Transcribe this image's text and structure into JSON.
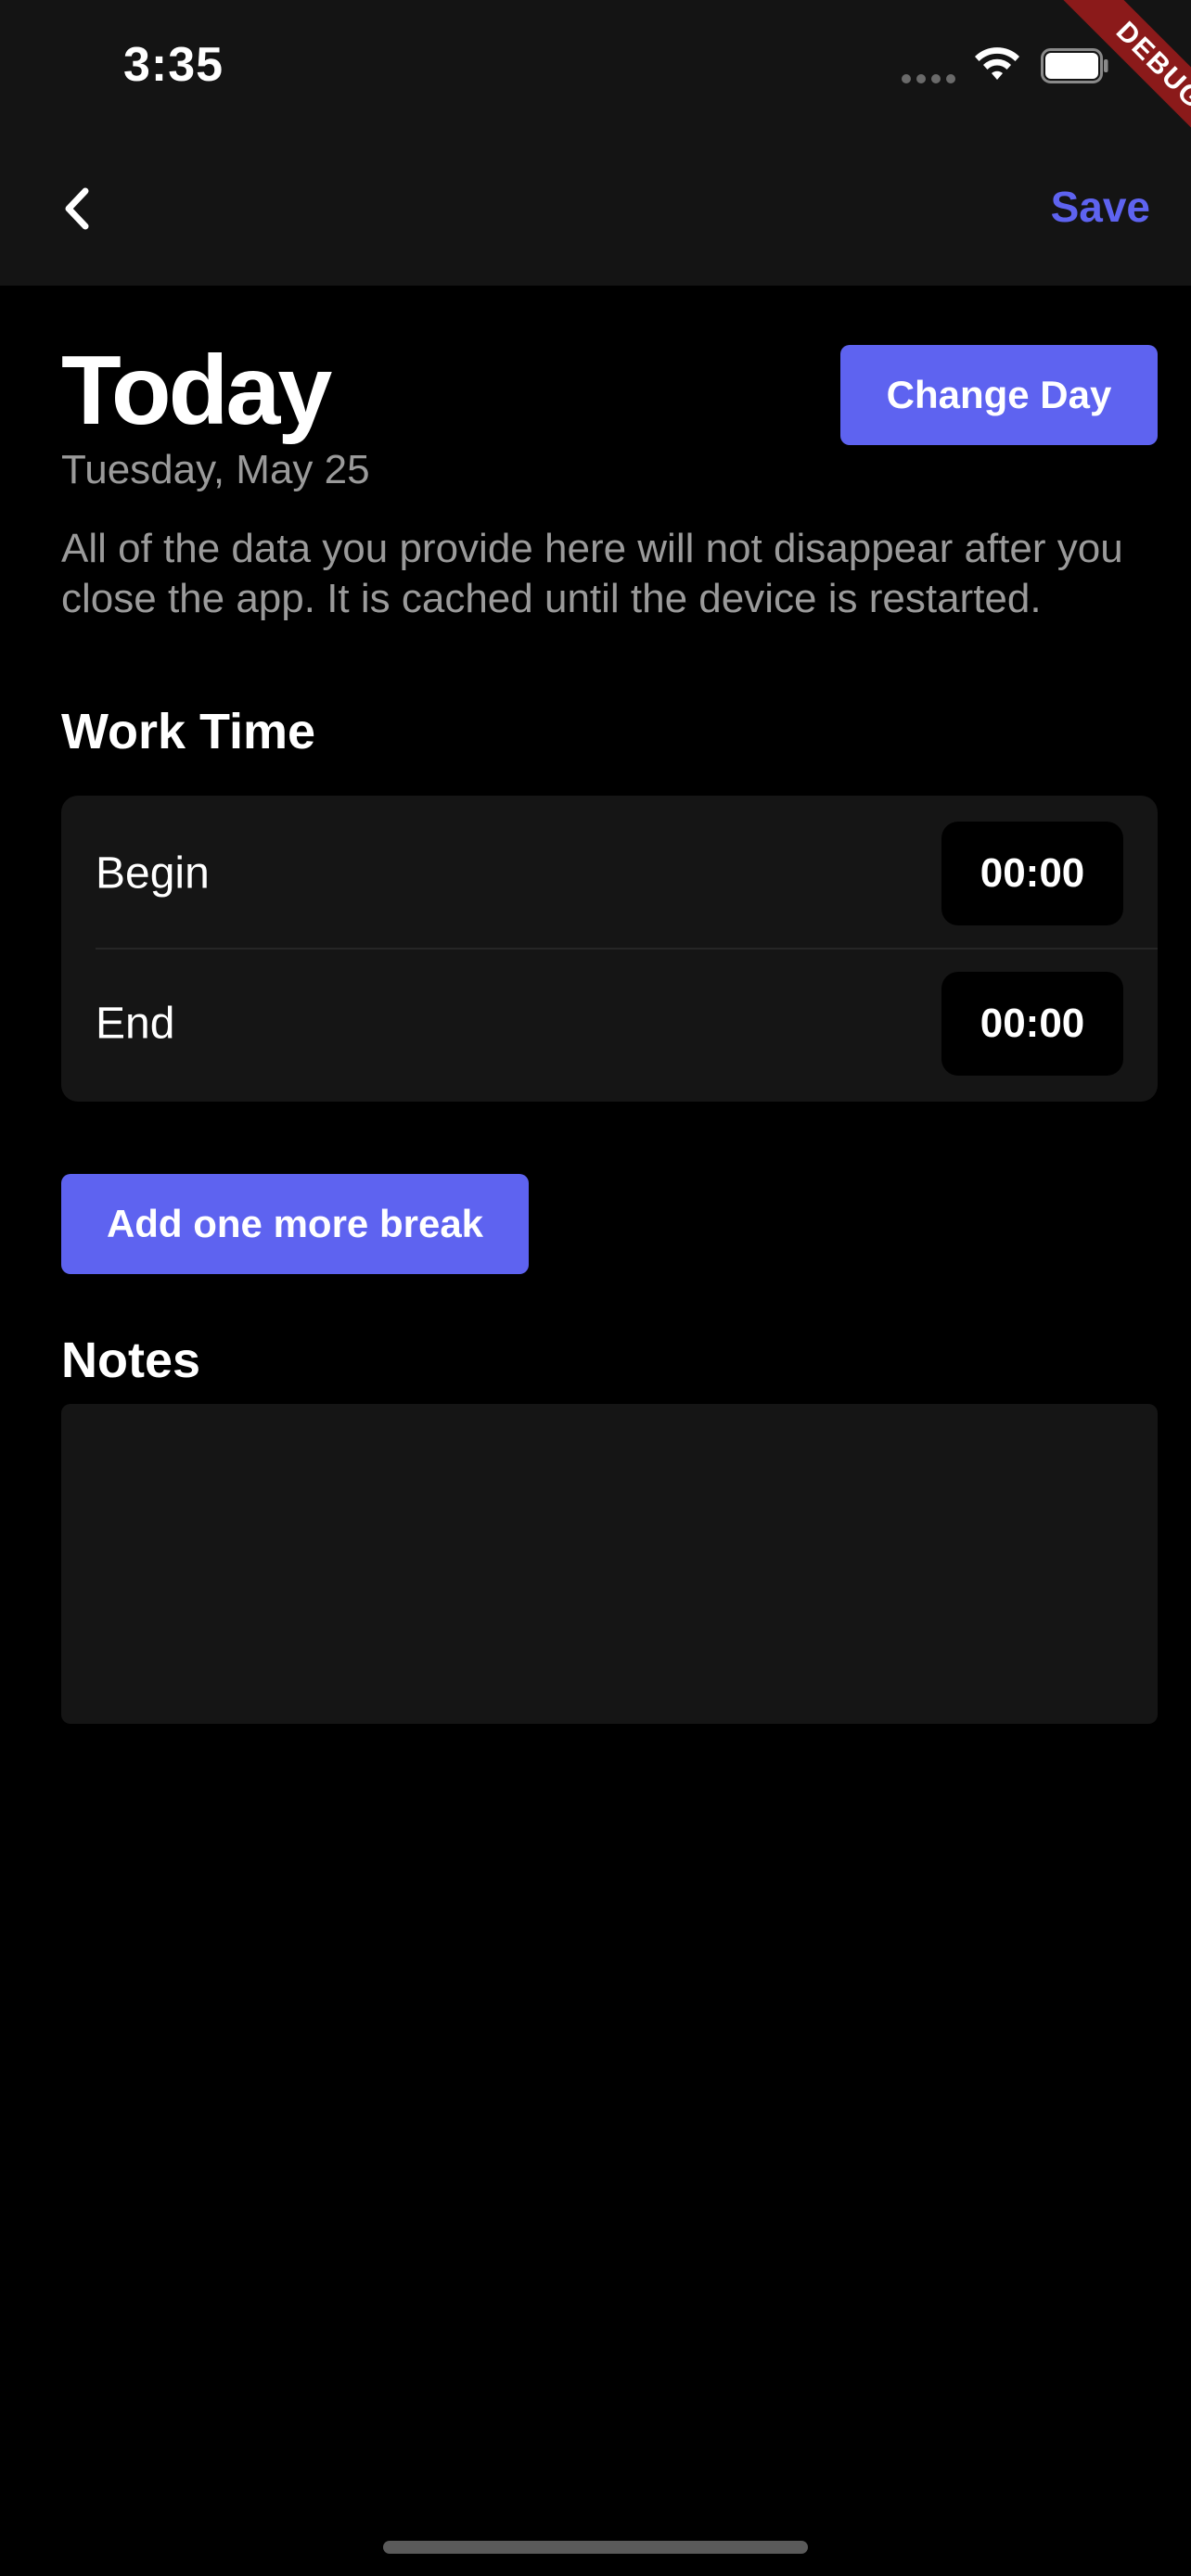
{
  "status_bar": {
    "time": "3:35",
    "debug_label": "DEBUG"
  },
  "nav": {
    "back_icon": "chevron-left-icon",
    "save_label": "Save"
  },
  "header": {
    "title": "Today",
    "date": "Tuesday, May 25",
    "change_day_label": "Change Day",
    "info": "All of the data you provide here will not disappear after you close the app. It is cached until the device is restarted."
  },
  "work_time": {
    "title": "Work Time",
    "rows": [
      {
        "label": "Begin",
        "value": "00:00"
      },
      {
        "label": "End",
        "value": "00:00"
      }
    ]
  },
  "add_break_label": "Add one more break",
  "notes": {
    "title": "Notes",
    "value": ""
  },
  "colors": {
    "accent": "#5e63f0",
    "background": "#000000",
    "surface": "#151515",
    "muted_text": "#9a9a9a",
    "debug_banner": "#8b1a1a"
  }
}
